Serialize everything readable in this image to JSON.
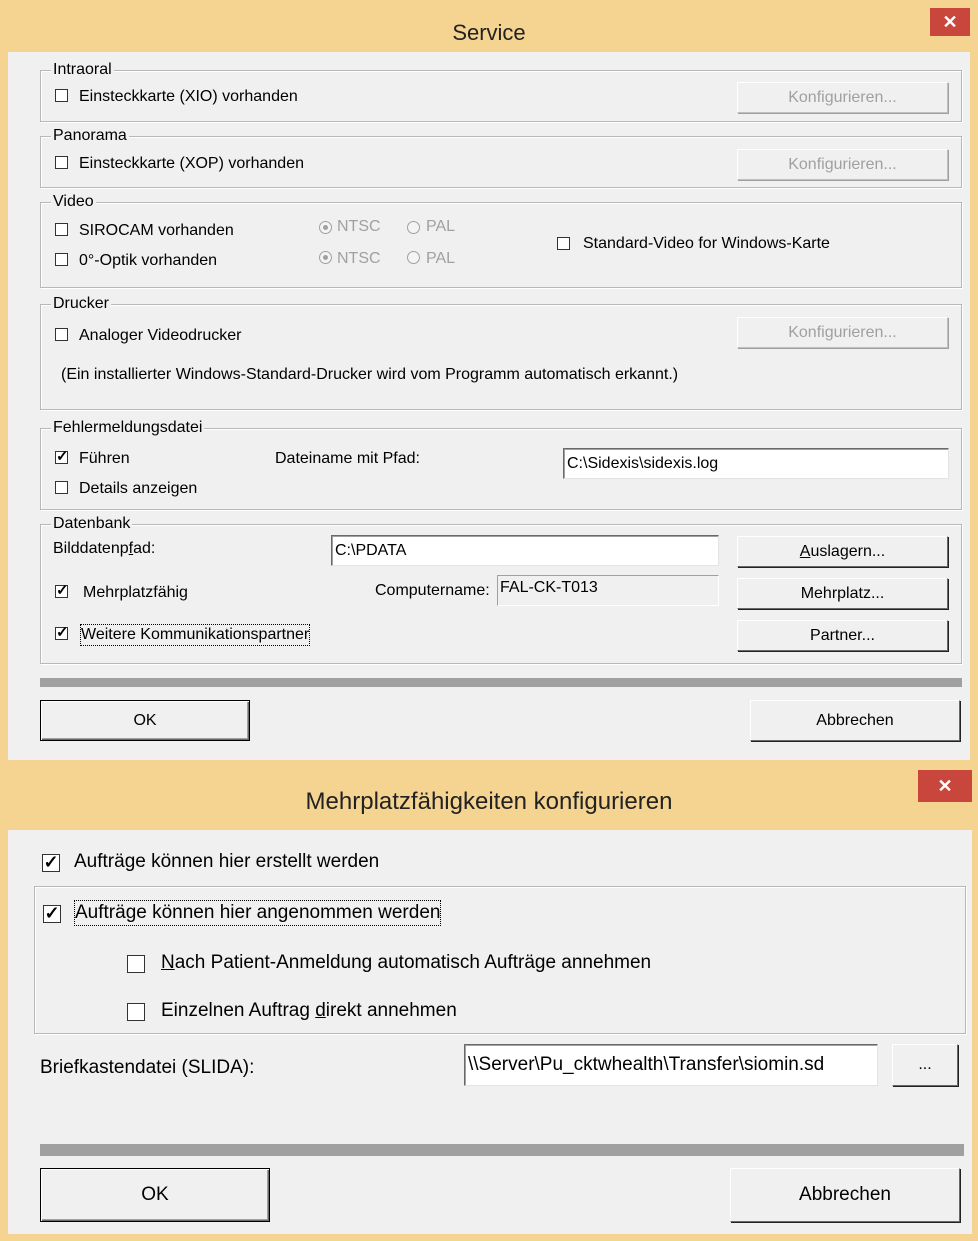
{
  "service": {
    "title": "Service",
    "intraoral": {
      "legend": "Intraoral",
      "card_label": "Einsteckkarte (XIO) vorhanden",
      "card_checked": false,
      "configure_label": "Konfigurieren..."
    },
    "panorama": {
      "legend": "Panorama",
      "card_label": "Einsteckkarte (XOP) vorhanden",
      "card_checked": false,
      "configure_label": "Konfigurieren..."
    },
    "video": {
      "legend": "Video",
      "sirocam_label": "SIROCAM vorhanden",
      "optik_label": "0°-Optik vorhanden",
      "ntsc_label": "NTSC",
      "pal_label": "PAL",
      "std_video_label": "Standard-Video for Windows-Karte"
    },
    "drucker": {
      "legend": "Drucker",
      "analog_label": "Analoger Videodrucker",
      "configure_label": "Konfigurieren...",
      "note": "(Ein installierter Windows-Standard-Drucker wird vom Programm automatisch erkannt.)"
    },
    "fehler": {
      "legend": "Fehlermeldungsdatei",
      "fuehren_label": "Führen",
      "details_label": "Details anzeigen",
      "filename_label": "Dateiname mit Pfad:",
      "filename_value": "C:\\Sidexis\\sidexis.log"
    },
    "datenbank": {
      "legend": "Datenbank",
      "bildpfad_label": "Bilddatenpfad:",
      "bildpfad_value": "C:\\PDATA",
      "auslagern_label": "Auslagern...",
      "mehrplatz_label": "Mehrplatzfähig",
      "computername_label": "Computername:",
      "computername_value": "FAL-CK-T013",
      "mehrplatz_button": "Mehrplatz...",
      "partner_check_label": "Weitere Kommunikationspartner",
      "partner_button": "Partner..."
    },
    "ok_label": "OK",
    "cancel_label": "Abbrechen"
  },
  "mehrplatz": {
    "title": "Mehrplatzfähigkeiten konfigurieren",
    "create_label": "Aufträge können hier erstellt werden",
    "accept_label": "Aufträge können hier angenommen werden",
    "auto_accept_label": "Nach Patient-Anmeldung automatisch Aufträge annehmen",
    "single_accept_label": "Einzelnen Auftrag direkt annehmen",
    "mailbox_label": "Briefkastendatei (SLIDA):",
    "mailbox_value": "\\\\Server\\Pu_cktwhealth\\Transfer\\siomin.sd",
    "browse_label": "...",
    "ok_label": "OK",
    "cancel_label": "Abbrechen"
  },
  "colors": {
    "titlebar": "#f5d491",
    "close_button": "#c9463d",
    "dialog_bg": "#f0f0f0"
  },
  "icons": {
    "close": "close-icon",
    "checkmark": "checkmark-icon"
  }
}
